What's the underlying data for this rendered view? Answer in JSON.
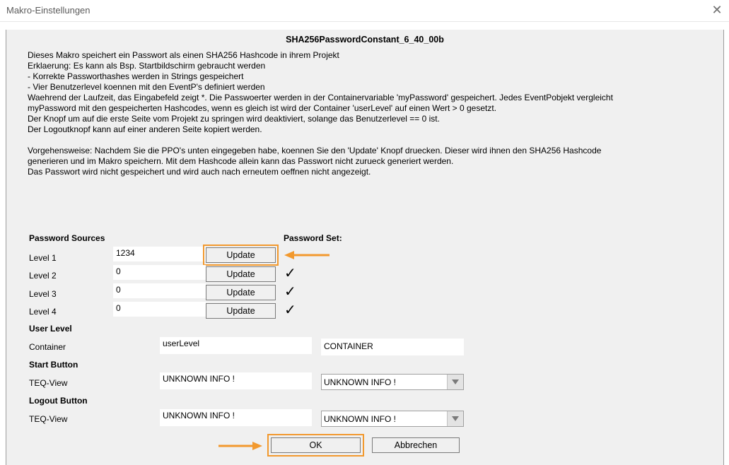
{
  "window": {
    "title": "Makro-Einstellungen"
  },
  "macro_name": "SHA256PasswordConstant_6_40_00b",
  "description": [
    "Dieses Makro speichert ein Passwort als einen SHA256 Hashcode in ihrem Projekt",
    "Erklaerung: Es kann als Bsp. Startbildschirm gebraucht werden",
    "- Korrekte Passworthashes werden in Strings gespeichert",
    "- Vier Benutzerlevel koennen mit den EventP's definiert werden",
    "Waehrend der Laufzeit, das Eingabefeld zeigt *. Die Passwoerter werden in der Containervariable 'myPassword' gespeichert. Jedes EventPobjekt vergleicht",
    "myPassword mit den gespeicherten Hashcodes, wenn es gleich ist wird der Container 'userLevel' auf einen Wert > 0 gesetzt.",
    "Der Knopf um auf die erste Seite vom Projekt zu springen wird deaktiviert, solange das Benutzerlevel == 0 ist.",
    "Der Logoutknopf kann auf einer anderen Seite kopiert werden.",
    "",
    "Vorgehensweise: Nachdem Sie die PPO's unten eingegeben habe, koennen Sie den 'Update' Knopf druecken. Dieser wird ihnen den SHA256 Hashcode",
    "generieren und im Makro speichern. Mit dem Hashcode allein kann das Passwort nicht zurueck generiert werden.",
    "Das Passwort wird nicht gespeichert und wird auch nach erneutem oeffnen nicht angezeigt."
  ],
  "password_sources_header": "Password Sources",
  "password_set_header": "Password Set:",
  "levels": [
    {
      "label": "Level 1",
      "value": "1234",
      "button": "Update",
      "set": ""
    },
    {
      "label": "Level 2",
      "value": "0",
      "button": "Update",
      "set": "✓"
    },
    {
      "label": "Level 3",
      "value": "0",
      "button": "Update",
      "set": "✓"
    },
    {
      "label": "Level 4",
      "value": "0",
      "button": "Update",
      "set": "✓"
    }
  ],
  "user_level": {
    "header": "User Level",
    "label": "Container",
    "value": "userLevel",
    "type": "CONTAINER"
  },
  "start_button": {
    "header": "Start Button",
    "label": "TEQ-View",
    "value": "UNKNOWN INFO !",
    "select": "UNKNOWN INFO !"
  },
  "logout_button": {
    "header": "Logout Button",
    "label": "TEQ-View",
    "value": "UNKNOWN INFO !",
    "select": "UNKNOWN INFO !"
  },
  "footer": {
    "ok": "OK",
    "cancel": "Abbrechen"
  },
  "colors": {
    "highlight": "#f2992e",
    "panel": "#f0f0f0"
  }
}
